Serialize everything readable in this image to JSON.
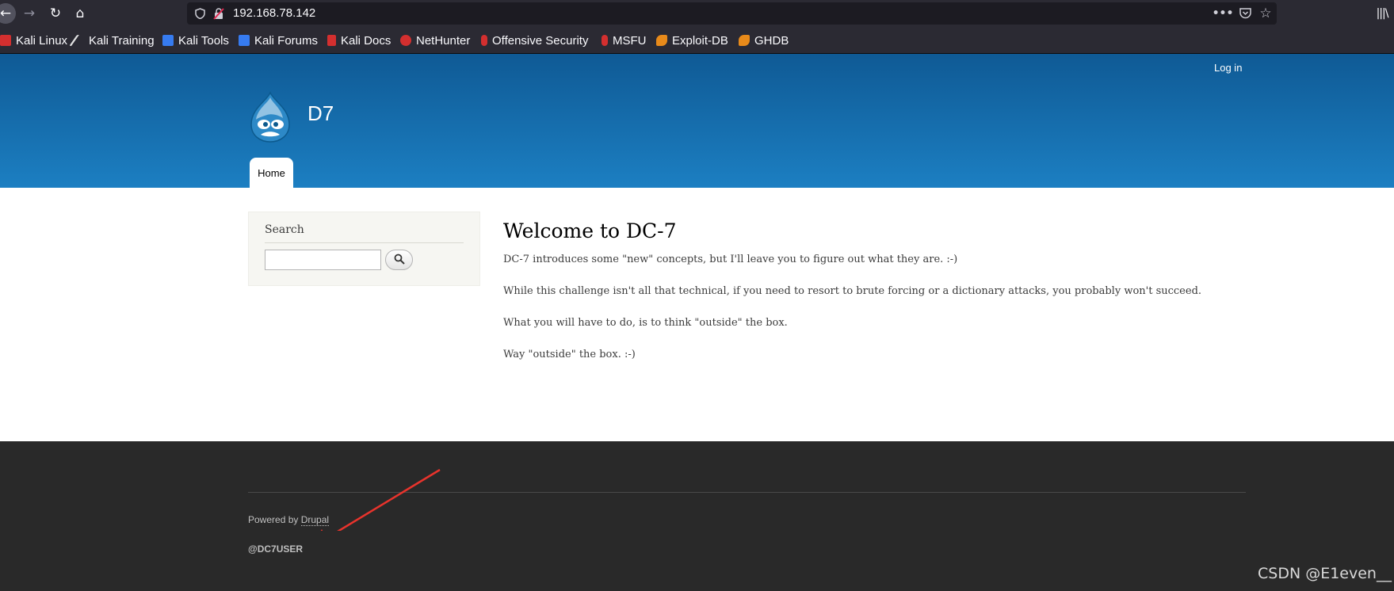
{
  "browser": {
    "url": "192.168.78.142",
    "bookmarks": [
      {
        "label": "Kali Linux",
        "icon": "kali-dragon-icon",
        "color": "#d32f2f"
      },
      {
        "label": "Kali Training",
        "icon": "kali-training-icon",
        "color": "#1a1a1a"
      },
      {
        "label": "Kali Tools",
        "icon": "kali-tools-icon",
        "color": "#367bf0"
      },
      {
        "label": "Kali Forums",
        "icon": "kali-forums-icon",
        "color": "#367bf0"
      },
      {
        "label": "Kali Docs",
        "icon": "kali-docs-icon",
        "color": "#d32f2f"
      },
      {
        "label": "NetHunter",
        "icon": "nethunter-icon",
        "color": "#d32f2f"
      },
      {
        "label": "Offensive Security",
        "icon": "offsec-icon",
        "color": "#d32f2f"
      },
      {
        "label": "MSFU",
        "icon": "msfu-icon",
        "color": "#d32f2f"
      },
      {
        "label": "Exploit-DB",
        "icon": "exploit-db-icon",
        "color": "#e88a1a"
      },
      {
        "label": "GHDB",
        "icon": "ghdb-icon",
        "color": "#e88a1a"
      }
    ]
  },
  "site": {
    "login_label": "Log in",
    "name": "D7",
    "tabs": [
      {
        "label": "Home"
      }
    ],
    "header_colors": {
      "top": "#0f5a95",
      "bottom": "#1c7fc2"
    }
  },
  "sidebar": {
    "search_title": "Search",
    "search_value": ""
  },
  "content": {
    "heading": "Welcome to DC-7",
    "paragraphs": [
      "DC-7 introduces some \"new\" concepts, but I'll leave you to figure out what they are.  :-)",
      "While this challenge isn't all that technical, if you need to resort to brute forcing or a dictionary attacks, you probably won't succeed.",
      "What you will have to do, is to think \"outside\" the box.",
      "Way \"outside\" the box.  :-)"
    ]
  },
  "footer": {
    "powered_prefix": "Powered by ",
    "powered_link": "Drupal",
    "user": "@DC7USER"
  },
  "annotation": {
    "arrow_color": "#e8332c"
  },
  "watermark": "CSDN @E1even__"
}
